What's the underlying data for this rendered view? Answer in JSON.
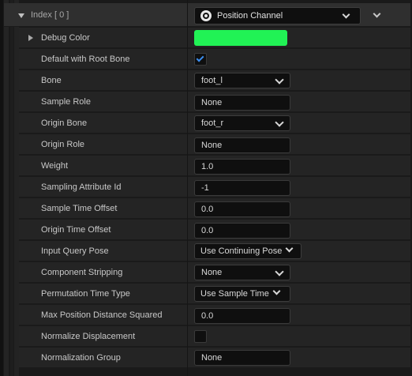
{
  "header": {
    "label": "Index [ 0 ]",
    "channel_value": "Position Channel",
    "channel_icon": "channel-icon"
  },
  "colors": {
    "debug_color": "#21f255",
    "checkbox_accent": "#3b8ef0"
  },
  "properties": {
    "debug_color": {
      "label": "Debug Color"
    },
    "default_with_root_bone": {
      "label": "Default with Root Bone",
      "checked": true
    },
    "bone": {
      "label": "Bone",
      "value": "foot_l"
    },
    "sample_role": {
      "label": "Sample Role",
      "value": "None"
    },
    "origin_bone": {
      "label": "Origin Bone",
      "value": "foot_r"
    },
    "origin_role": {
      "label": "Origin Role",
      "value": "None"
    },
    "weight": {
      "label": "Weight",
      "value": "1.0"
    },
    "sampling_attribute_id": {
      "label": "Sampling Attribute Id",
      "value": "-1"
    },
    "sample_time_offset": {
      "label": "Sample Time Offset",
      "value": "0.0"
    },
    "origin_time_offset": {
      "label": "Origin Time Offset",
      "value": "0.0"
    },
    "input_query_pose": {
      "label": "Input Query Pose",
      "value": "Use Continuing Pose"
    },
    "component_stripping": {
      "label": "Component Stripping",
      "value": "None"
    },
    "permutation_time_type": {
      "label": "Permutation Time Type",
      "value": "Use Sample Time"
    },
    "max_position_distance_squared": {
      "label": "Max Position Distance Squared",
      "value": "0.0"
    },
    "normalize_displacement": {
      "label": "Normalize Displacement",
      "checked": false
    },
    "normalization_group": {
      "label": "Normalization Group",
      "value": "None"
    }
  }
}
